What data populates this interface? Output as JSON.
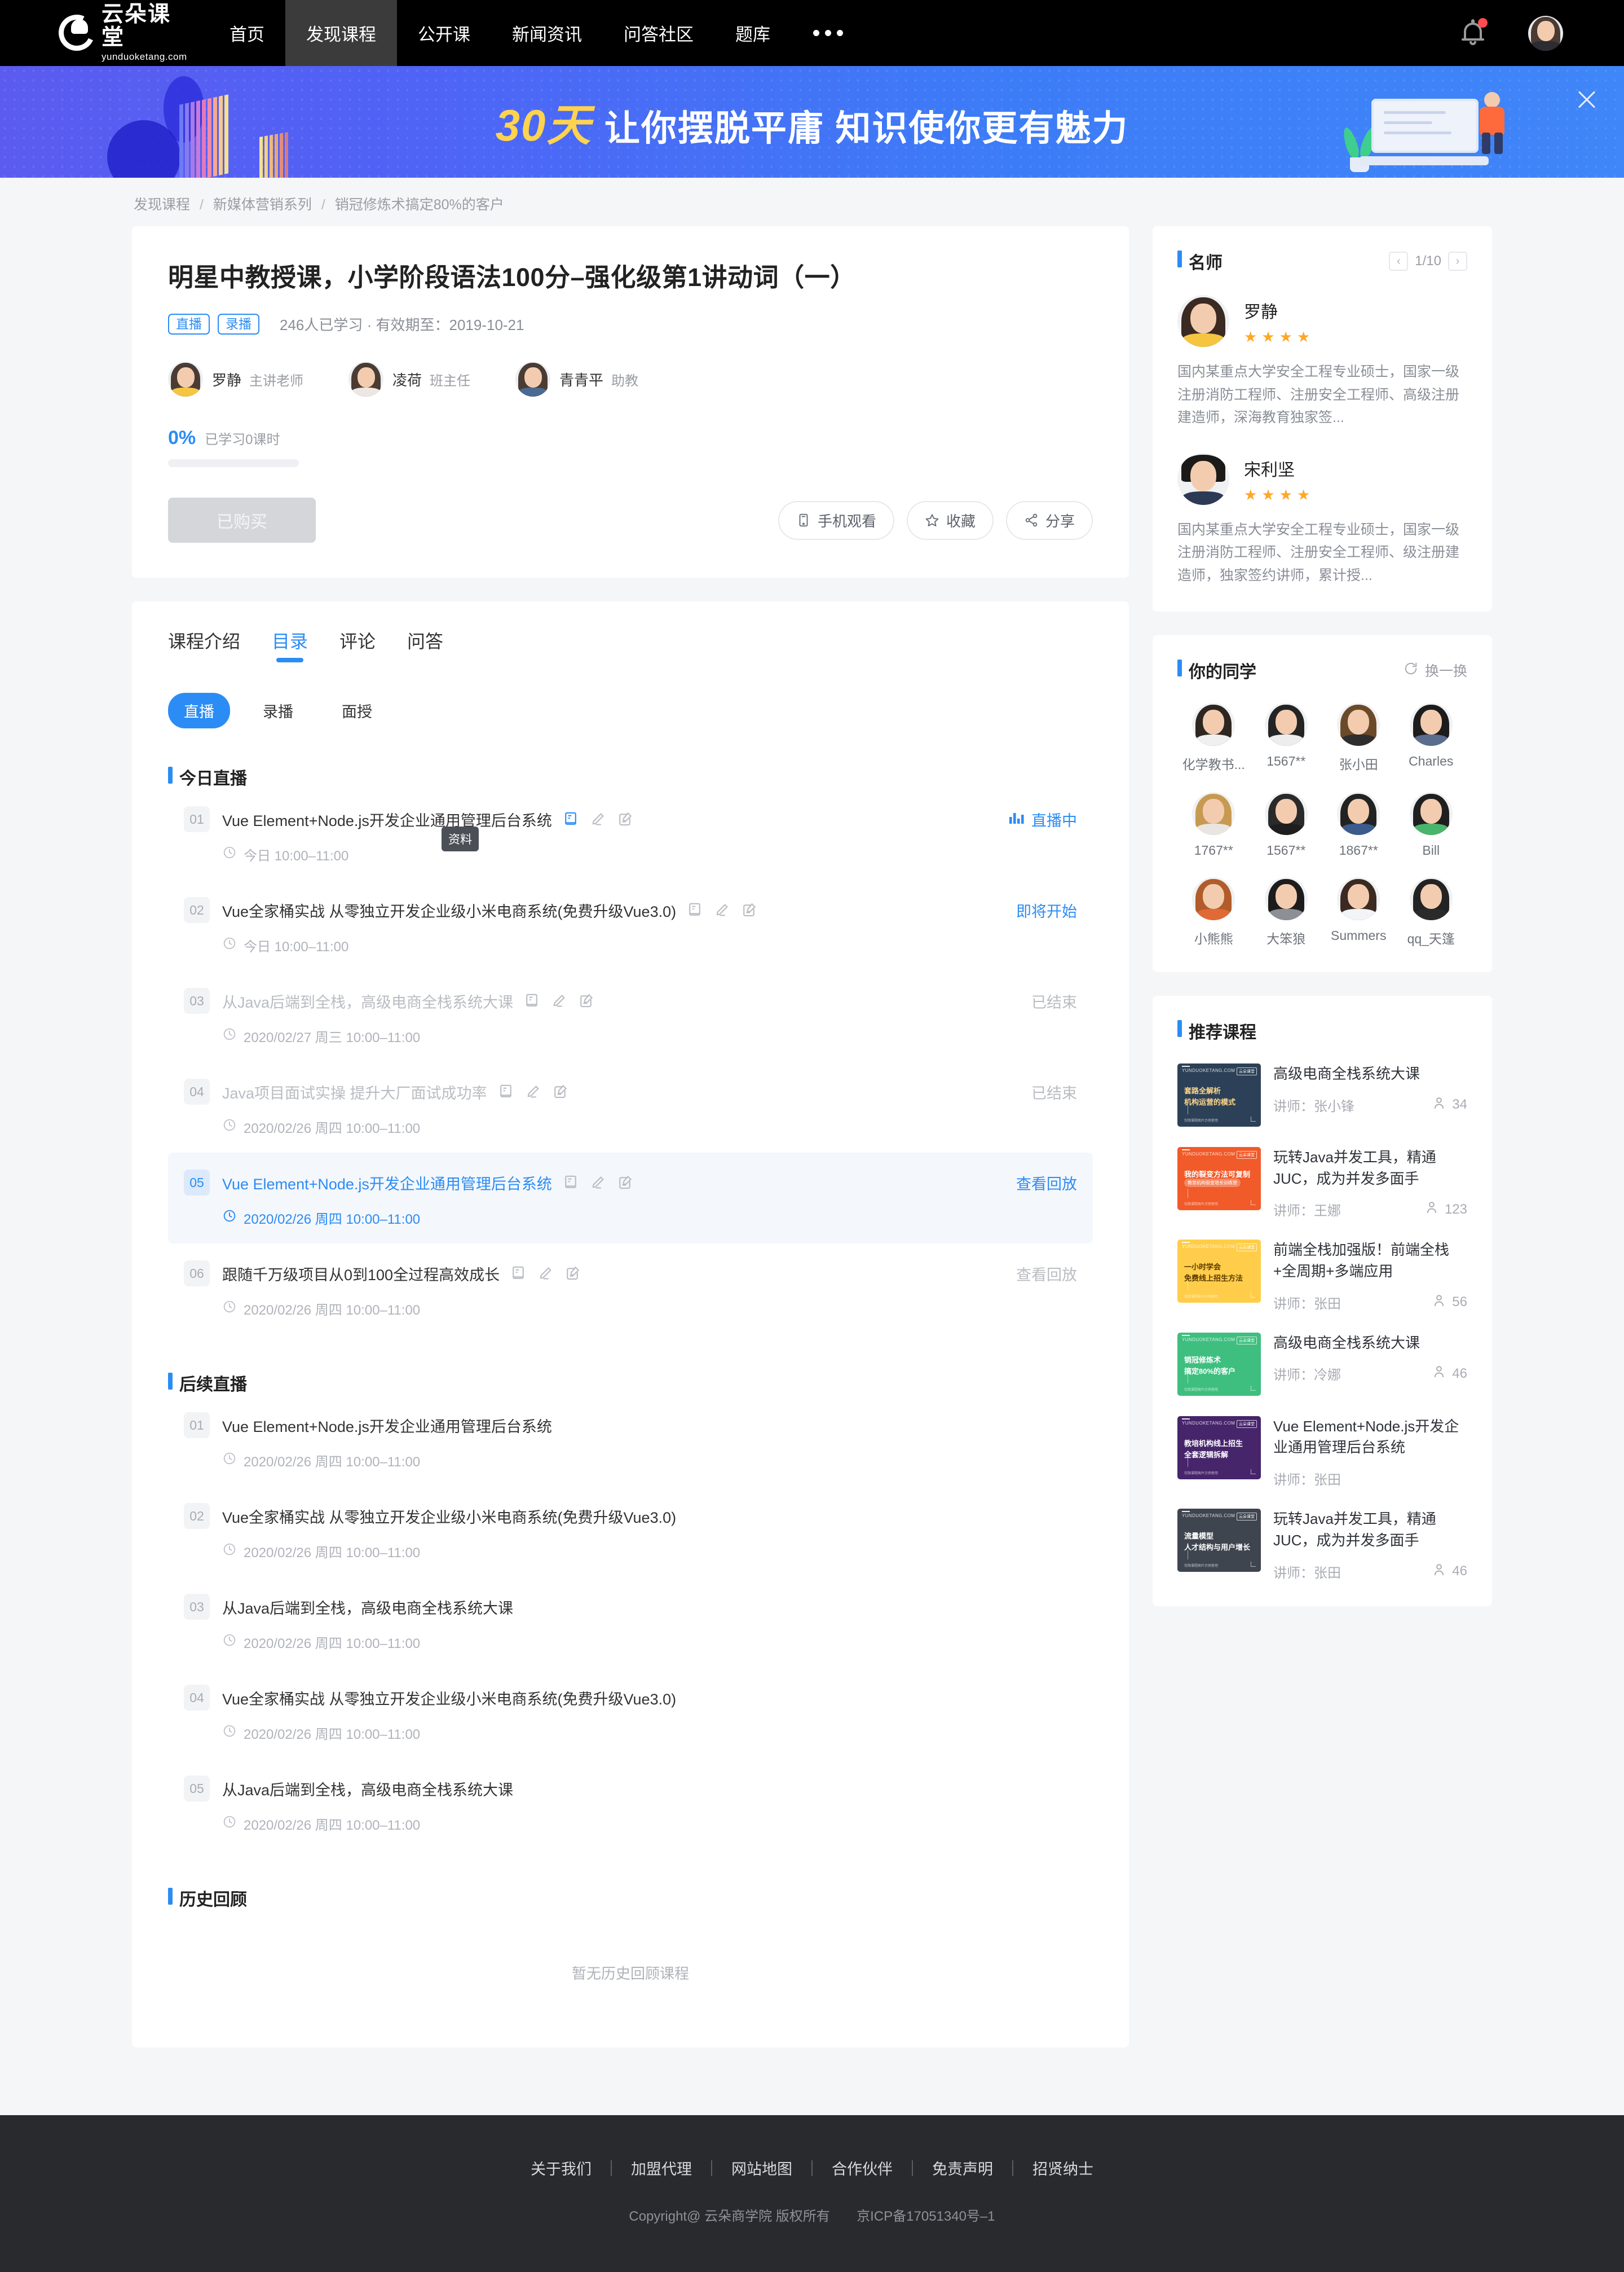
{
  "nav": {
    "logo_main": "云朵课堂",
    "logo_sub": "yunduoketang.com",
    "items": [
      {
        "label": "首页",
        "active": false
      },
      {
        "label": "发现课程",
        "active": true
      },
      {
        "label": "公开课",
        "active": false
      },
      {
        "label": "新闻资讯",
        "active": false
      },
      {
        "label": "问答社区",
        "active": false
      },
      {
        "label": "题库",
        "active": false
      }
    ],
    "more_icon": "ellipsis-icon",
    "bell_icon": "bell-icon",
    "avatar_icon": "user-avatar"
  },
  "banner": {
    "number": "30天",
    "text": "让你摆脱平庸 知识使你更有魅力",
    "close_icon": "close-icon",
    "bg_color": "#4169f5",
    "accent_color": "#ffd34e"
  },
  "breadcrumb": {
    "items": [
      "发现课程",
      "新媒体营销系列",
      "销冠修炼术搞定80%的客户"
    ],
    "separator": "/"
  },
  "course": {
    "title": "明星中教授课，小学阶段语法100分–强化级第1讲动词（一）",
    "tags": [
      "直播",
      "录播"
    ],
    "meta": "246人已学习 · 有效期至：2019-10-21",
    "teachers": [
      {
        "name": "罗静",
        "role": "主讲老师"
      },
      {
        "name": "凌荷",
        "role": "班主任"
      },
      {
        "name": "青青平",
        "role": "助教"
      }
    ],
    "progress_pct": "0%",
    "progress_label": "已学习0课时",
    "progress_value": 0,
    "buy_button": "已购买",
    "actions": [
      {
        "label": "手机观看",
        "icon": "phone-icon"
      },
      {
        "label": "收藏",
        "icon": "star-icon"
      },
      {
        "label": "分享",
        "icon": "share-icon"
      }
    ]
  },
  "tabs": [
    {
      "label": "课程介绍",
      "active": false
    },
    {
      "label": "目录",
      "active": true
    },
    {
      "label": "评论",
      "active": false
    },
    {
      "label": "问答",
      "active": false
    }
  ],
  "subtabs": [
    {
      "label": "直播",
      "active": true
    },
    {
      "label": "录播",
      "active": false
    },
    {
      "label": "面授",
      "active": false
    }
  ],
  "tooltip": "资料",
  "sections": [
    {
      "title": "今日直播",
      "lessons": [
        {
          "num": "01",
          "title": "Vue Element+Node.js开发企业通用管理后台系统",
          "time": "今日 10:00–11:00",
          "status": "直播中",
          "state": "live",
          "icons": true,
          "icon_active": true
        },
        {
          "num": "02",
          "title": "Vue全家桶实战 从零独立开发企业级小米电商系统(免费升级Vue3.0)",
          "time": "今日 10:00–11:00",
          "status": "即将开始",
          "state": "upcoming",
          "icons": true,
          "icon_active": false
        },
        {
          "num": "03",
          "title": "从Java后端到全栈，高级电商全栈系统大课",
          "time": "2020/02/27 周三 10:00–11:00",
          "status": "已结束",
          "state": "ended",
          "icons": true,
          "icon_active": false
        },
        {
          "num": "04",
          "title": "Java项目面试实操 提升大厂面试成功率",
          "time": "2020/02/26 周四 10:00–11:00",
          "status": "已结束",
          "state": "ended",
          "icons": true,
          "icon_active": false
        },
        {
          "num": "05",
          "title": "Vue Element+Node.js开发企业通用管理后台系统",
          "time": "2020/02/26 周四 10:00–11:00",
          "status": "查看回放",
          "state": "highlight",
          "icons": true,
          "icon_active": false
        },
        {
          "num": "06",
          "title": "跟随千万级项目从0到100全过程高效成长",
          "time": "2020/02/26 周四 10:00–11:00",
          "status": "查看回放",
          "state": "replay",
          "icons": true,
          "icon_active": false
        }
      ]
    },
    {
      "title": "后续直播",
      "lessons": [
        {
          "num": "01",
          "title": "Vue Element+Node.js开发企业通用管理后台系统",
          "time": "2020/02/26 周四 10:00–11:00",
          "status": "",
          "state": "plain",
          "icons": false
        },
        {
          "num": "02",
          "title": "Vue全家桶实战 从零独立开发企业级小米电商系统(免费升级Vue3.0)",
          "time": "2020/02/26 周四 10:00–11:00",
          "status": "",
          "state": "plain",
          "icons": false
        },
        {
          "num": "03",
          "title": "从Java后端到全栈，高级电商全栈系统大课",
          "time": "2020/02/26 周四 10:00–11:00",
          "status": "",
          "state": "plain",
          "icons": false
        },
        {
          "num": "04",
          "title": "Vue全家桶实战 从零独立开发企业级小米电商系统(免费升级Vue3.0)",
          "time": "2020/02/26 周四 10:00–11:00",
          "status": "",
          "state": "plain",
          "icons": false
        },
        {
          "num": "05",
          "title": "从Java后端到全栈，高级电商全栈系统大课",
          "time": "2020/02/26 周四 10:00–11:00",
          "status": "",
          "state": "plain",
          "icons": false
        }
      ]
    }
  ],
  "history": {
    "title": "历史回顾",
    "empty": "暂无历史回顾课程"
  },
  "sidebar": {
    "teachers_panel": {
      "title": "名师",
      "page": "1/10",
      "prev_icon": "chevron-left-icon",
      "next_icon": "chevron-right-icon",
      "list": [
        {
          "name": "罗静",
          "stars": 4,
          "desc": "国内某重点大学安全工程专业硕士，国家一级注册消防工程师、注册安全工程师、高级注册建造师，深海教育独家签..."
        },
        {
          "name": "宋利坚",
          "stars": 4,
          "desc": "国内某重点大学安全工程专业硕士，国家一级注册消防工程师、注册安全工程师、级注册建造师，独家签约讲师，累计授..."
        }
      ]
    },
    "classmates_panel": {
      "title": "你的同学",
      "refresh_label": "换一换",
      "refresh_icon": "refresh-icon",
      "list": [
        {
          "name": "化学教书..."
        },
        {
          "name": "1567**"
        },
        {
          "name": "张小田"
        },
        {
          "name": "Charles"
        },
        {
          "name": "1767**"
        },
        {
          "name": "1567**"
        },
        {
          "name": "1867**"
        },
        {
          "name": "Bill"
        },
        {
          "name": "小熊熊"
        },
        {
          "name": "大笨狼"
        },
        {
          "name": "Summers"
        },
        {
          "name": "qq_天篷"
        }
      ]
    },
    "recommend_panel": {
      "title": "推荐课程",
      "teacher_prefix": "讲师：",
      "list": [
        {
          "name": "高级电商全栈系统大课",
          "teacher": "张小锋",
          "count": "34",
          "thumb_color": "#2c4157",
          "thumb_l1": "套路全解析",
          "thumb_l2": "机构运营的模式",
          "thumb_pill": "",
          "thumb_text_color": "#ffd78a"
        },
        {
          "name": "玩转Java并发工具，精通JUC，成为并发多面手",
          "teacher": "王娜",
          "count": "123",
          "thumb_color": "#f15a29",
          "thumb_l1": "我的裂变方法可复制",
          "thumb_l2": "",
          "thumb_pill": "教育机构裂变增长训练营",
          "thumb_text_color": "#ffffff"
        },
        {
          "name": "前端全栈加强版！前端全栈+全周期+多端应用",
          "teacher": "张田",
          "count": "56",
          "thumb_color": "#ffcd4a",
          "thumb_l1": "一小时学会",
          "thumb_l2": "免费线上招生方法",
          "thumb_pill": "",
          "thumb_text_color": "#5a3a00"
        },
        {
          "name": "高级电商全栈系统大课",
          "teacher": "冷娜",
          "count": "46",
          "thumb_color": "#3fbf7f",
          "thumb_l1": "销冠修炼术",
          "thumb_l2": "搞定80%的客户",
          "thumb_pill": "",
          "thumb_text_color": "#ffffff"
        },
        {
          "name": "Vue Element+Node.js开发企业通用管理后台系统",
          "teacher": "张田",
          "count": "",
          "thumb_color": "#46256b",
          "thumb_l1": "教培机构线上招生",
          "thumb_l2": "全套逻辑拆解",
          "thumb_pill": "",
          "thumb_text_color": "#ffffff"
        },
        {
          "name": "玩转Java并发工具，精通JUC，成为并发多面手",
          "teacher": "张田",
          "count": "46",
          "thumb_color": "#3f454f",
          "thumb_l1": "流量模型",
          "thumb_l2": "人才结构与用户增长",
          "thumb_pill": "",
          "thumb_text_color": "#ffffff"
        }
      ]
    }
  },
  "footer": {
    "links": [
      "关于我们",
      "加盟代理",
      "网站地图",
      "合作伙伴",
      "免责声明",
      "招贤纳士"
    ],
    "copyright": "Copyright@ 云朵商学院  版权所有",
    "icp": "京ICP备17051340号–1"
  }
}
